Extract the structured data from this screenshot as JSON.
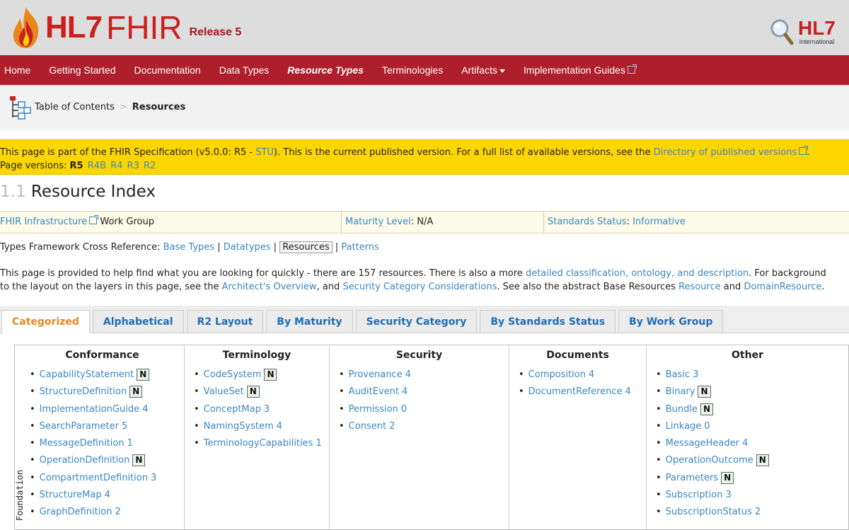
{
  "header": {
    "logo_hl7": "HL7",
    "logo_fhir": "FHIR",
    "release": "Release 5",
    "intl_logo": "HL7",
    "intl_sub": "International"
  },
  "nav": {
    "items": [
      "Home",
      "Getting Started",
      "Documentation",
      "Data Types",
      "Resource Types",
      "Terminologies",
      "Artifacts",
      "Implementation Guides"
    ],
    "active": "Resource Types"
  },
  "breadcrumb": {
    "toc": "Table of Contents",
    "sep": ">",
    "current": "Resources"
  },
  "notice": {
    "p1": "This page is part of the FHIR Specification (v5.0.0: R5 - ",
    "stu": "STU",
    "p2": "). This is the current published version. For a full list of available versions, see the ",
    "dir_link": "Directory of published versions",
    "p3": ".",
    "versions_label": "Page versions: ",
    "versions": [
      "R5",
      "R4B",
      "R4",
      "R3",
      "R2"
    ]
  },
  "title": {
    "number": "1.1",
    "text": "Resource Index"
  },
  "workgroup": {
    "wg_link": "FHIR Infrastructure",
    "wg_suffix": "Work Group",
    "maturity_label": "Maturity Level",
    "maturity_value": ": N/A",
    "status_label": "Standards Status",
    "status_value": "Informative"
  },
  "xref": {
    "label": "Types Framework Cross Reference: ",
    "items": [
      "Base Types",
      "Datatypes",
      "Resources",
      "Patterns"
    ],
    "sep": " | "
  },
  "para": {
    "l1a": "This page is provided to help find what you are looking for quickly - there are 157 resources. There is also a more ",
    "l1link": "detailed classification, ontology, and description",
    "l1b": ". For background",
    "l2a": "to the layout on the layers in this page, see the ",
    "l2link1": "Architect's Overview",
    "l2b": ", and ",
    "l2link2": "Security Category Considerations",
    "l2c": ". See also the abstract Base Resources ",
    "l2link3": "Resource",
    "l2d": " and ",
    "l2link4": "DomainResource",
    "l2e": "."
  },
  "tabs": [
    "Categorized",
    "Alphabetical",
    "R2 Layout",
    "By Maturity",
    "Security Category",
    "By Standards Status",
    "By Work Group"
  ],
  "grid": {
    "row_label": "Foundation",
    "columns": [
      {
        "title": "Conformance",
        "items": [
          {
            "name": "CapabilityStatement",
            "level": "N"
          },
          {
            "name": "StructureDefinition",
            "level": "N"
          },
          {
            "name": "ImplementationGuide",
            "level": "4"
          },
          {
            "name": "SearchParameter",
            "level": "5"
          },
          {
            "name": "MessageDefinition",
            "level": "1"
          },
          {
            "name": "OperationDefinition",
            "level": "N"
          },
          {
            "name": "CompartmentDefinition",
            "level": "3"
          },
          {
            "name": "StructureMap",
            "level": "4"
          },
          {
            "name": "GraphDefinition",
            "level": "2"
          }
        ]
      },
      {
        "title": "Terminology",
        "items": [
          {
            "name": "CodeSystem",
            "level": "N"
          },
          {
            "name": "ValueSet",
            "level": "N"
          },
          {
            "name": "ConceptMap",
            "level": "3"
          },
          {
            "name": "NamingSystem",
            "level": "4"
          },
          {
            "name": "TerminologyCapabilities",
            "level": "1"
          }
        ]
      },
      {
        "title": "Security",
        "items": [
          {
            "name": "Provenance",
            "level": "4"
          },
          {
            "name": "AuditEvent",
            "level": "4"
          },
          {
            "name": "Permission",
            "level": "0"
          },
          {
            "name": "Consent",
            "level": "2"
          }
        ]
      },
      {
        "title": "Documents",
        "items": [
          {
            "name": "Composition",
            "level": "4"
          },
          {
            "name": "DocumentReference",
            "level": "4"
          }
        ]
      },
      {
        "title": "Other",
        "items": [
          {
            "name": "Basic",
            "level": "3"
          },
          {
            "name": "Binary",
            "level": "N"
          },
          {
            "name": "Bundle",
            "level": "N"
          },
          {
            "name": "Linkage",
            "level": "0"
          },
          {
            "name": "MessageHeader",
            "level": "4"
          },
          {
            "name": "OperationOutcome",
            "level": "N"
          },
          {
            "name": "Parameters",
            "level": "N"
          },
          {
            "name": "Subscription",
            "level": "3"
          },
          {
            "name": "SubscriptionStatus",
            "level": "2"
          }
        ]
      }
    ]
  },
  "colors": {
    "nav_bg": "#ae1f2b",
    "brand_red": "#cc1f1f",
    "link": "#3a87c4",
    "notice_bg": "#fdd600",
    "tab_active": "#e8881c"
  }
}
